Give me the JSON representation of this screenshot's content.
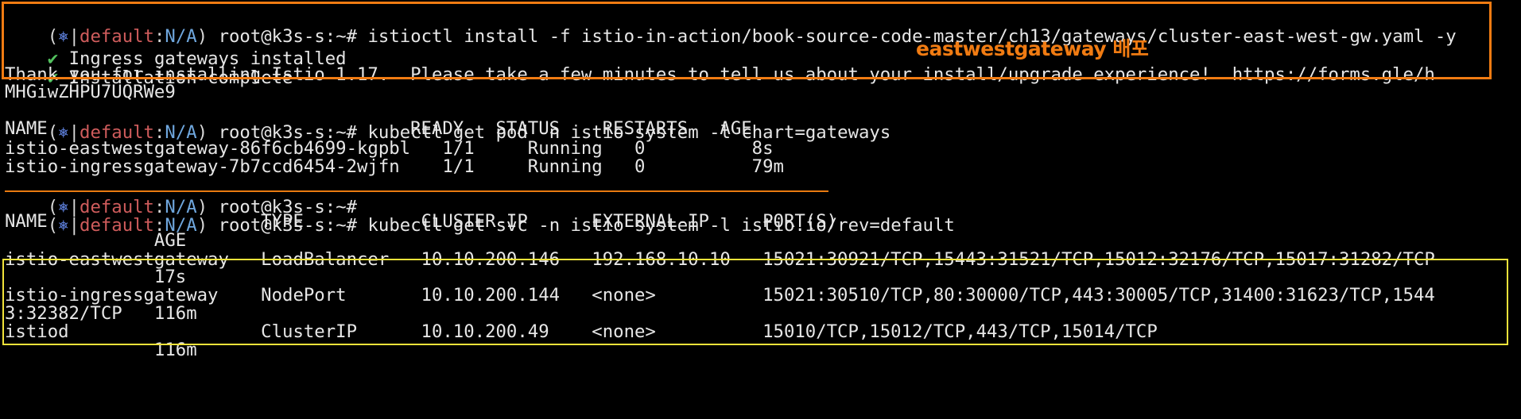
{
  "prompt": {
    "open": "(",
    "icon": "⎈",
    "sep": "|",
    "context": "default",
    "colon": ":",
    "namespace": "N/A",
    "close": ")",
    "userhost": " root@k3s-s:~# "
  },
  "lines": {
    "l1_cmd": "istioctl install -f istio-in-action/book-source-code-master/ch13/gateways/cluster-east-west-gw.yaml -y",
    "l2_check": "✔",
    "l2_text": " Ingress gateways installed",
    "l3_check": "✔",
    "l3_text": " Installation complete",
    "l4": "Thank you for installing Istio 1.17.  Please take a few minutes to tell us about your install/upgrade experience!  https://forms.gle/h",
    "l5": "MHGiwZHPU7UQRWe9",
    "l6_cmd": "kubectl get pod -n istio-system -l chart=gateways",
    "l7": "NAME                                  READY   STATUS    RESTARTS   AGE",
    "l8": "istio-eastwestgateway-86f6cb4699-kgpbl   1/1     Running   0          8s",
    "l9": "istio-ingressgateway-7b7ccd6454-2wjfn    1/1     Running   0          79m",
    "l10_cmd": "",
    "l11_cmd": "kubectl get svc -n istio-system -l istio.io/rev=default",
    "l12": "NAME                    TYPE           CLUSTER-IP      EXTERNAL-IP     PORT(S)",
    "l13": "              AGE",
    "l14": "istio-eastwestgateway   LoadBalancer   10.10.200.146   192.168.10.10   15021:30921/TCP,15443:31521/TCP,15012:32176/TCP,15017:31282/TCP",
    "l15": "              17s",
    "l16": "istio-ingressgateway    NodePort       10.10.200.144   <none>          15021:30510/TCP,80:30000/TCP,443:30005/TCP,31400:31623/TCP,1544",
    "l17": "3:32382/TCP   116m",
    "l18": "istiod                  ClusterIP      10.10.200.49    <none>          15010/TCP,15012/TCP,443/TCP,15014/TCP",
    "l19": "              116m"
  },
  "annotation": "eastwestgateway 배포",
  "colors": {
    "orange": "#f07b12",
    "yellow": "#f2e33a",
    "context_red": "#cf5c5c",
    "namespace_blue": "#6fa7de",
    "check_green": "#52c15e"
  }
}
